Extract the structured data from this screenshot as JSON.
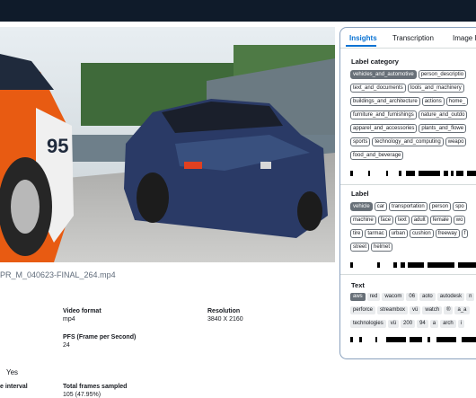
{
  "video": {
    "filename": "PR_M_040623-FINAL_264.mp4"
  },
  "metadata": {
    "video_format_label": "Video format",
    "video_format_value": "mp4",
    "resolution_label": "Resolution",
    "resolution_value": "3840 X 2160",
    "fps_label": "PFS (Frame per Second)",
    "fps_value": "24",
    "yes_value": "Yes",
    "interval_label": "e interval",
    "total_frames_label": "Total frames sampled",
    "total_frames_value": "105 (47.95%)"
  },
  "panel": {
    "tabs": [
      "Insights",
      "Transcription",
      "Image I"
    ],
    "label_category": {
      "title": "Label category",
      "rows": [
        [
          {
            "t": "vehicles_and_automotive",
            "sel": true
          },
          {
            "t": "person_descriptio"
          }
        ],
        [
          {
            "t": "text_and_documents"
          },
          {
            "t": "tools_and_machinery"
          }
        ],
        [
          {
            "t": "buildings_and_architecture"
          },
          {
            "t": "actions"
          },
          {
            "t": "home_"
          }
        ],
        [
          {
            "t": "furniture_and_furnishings"
          },
          {
            "t": "nature_and_outdo"
          }
        ],
        [
          {
            "t": "apparel_and_accessories"
          },
          {
            "t": "plants_and_flowe"
          }
        ],
        [
          {
            "t": "sports"
          },
          {
            "t": "technology_and_computing"
          },
          {
            "t": "weapo"
          }
        ],
        [
          {
            "t": "food_and_beverage"
          }
        ]
      ]
    },
    "label": {
      "title": "Label",
      "rows": [
        [
          {
            "t": "vehicle",
            "sel": true
          },
          {
            "t": "car"
          },
          {
            "t": "transportation"
          },
          {
            "t": "person"
          },
          {
            "t": "spo"
          }
        ],
        [
          {
            "t": "machine"
          },
          {
            "t": "face"
          },
          {
            "t": "text"
          },
          {
            "t": "adult"
          },
          {
            "t": "female"
          },
          {
            "t": "wo"
          }
        ],
        [
          {
            "t": "tire"
          },
          {
            "t": "tarmac"
          },
          {
            "t": "urban"
          },
          {
            "t": "cushion"
          },
          {
            "t": "freeway"
          },
          {
            "t": "f"
          }
        ],
        [
          {
            "t": "street"
          },
          {
            "t": "helmet"
          }
        ]
      ]
    },
    "text": {
      "title": "Text",
      "rows": [
        [
          {
            "t": "aws",
            "sel": true
          },
          {
            "t": "red"
          },
          {
            "t": "wacom"
          },
          {
            "t": "06"
          },
          {
            "t": "aoto"
          },
          {
            "t": "autodesk"
          },
          {
            "t": "n"
          }
        ],
        [
          {
            "t": "perforce"
          },
          {
            "t": "streambox"
          },
          {
            "t": "vü"
          },
          {
            "t": "watch"
          },
          {
            "t": "®"
          },
          {
            "t": "a_a"
          }
        ],
        [
          {
            "t": "technologies"
          },
          {
            "t": "vü"
          },
          {
            "t": "200"
          },
          {
            "t": "94"
          },
          {
            "t": "a"
          },
          {
            "t": "arch"
          },
          {
            "t": "i"
          }
        ]
      ]
    }
  }
}
